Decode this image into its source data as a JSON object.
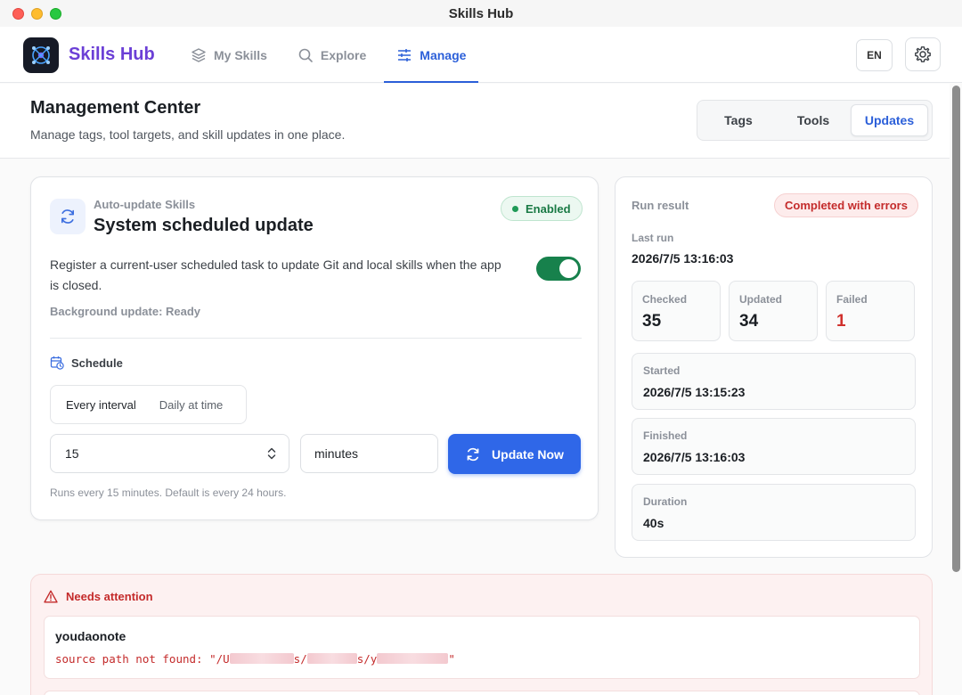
{
  "window": {
    "title": "Skills Hub"
  },
  "header": {
    "brand": "Skills Hub",
    "nav": [
      {
        "label": "My Skills",
        "icon": "layers-icon"
      },
      {
        "label": "Explore",
        "icon": "search-icon"
      },
      {
        "label": "Manage",
        "icon": "sliders-icon",
        "active": true
      }
    ],
    "language": "EN"
  },
  "page": {
    "title": "Management Center",
    "subtitle": "Manage tags, tool targets, and skill updates in one place.",
    "tabs": [
      "Tags",
      "Tools",
      "Updates"
    ],
    "active_tab": "Updates"
  },
  "auto_update": {
    "kicker": "Auto-update Skills",
    "title": "System scheduled update",
    "status_badge": "Enabled",
    "description": "Register a current-user scheduled task to update Git and local skills when the app is closed.",
    "background_status": "Background update: Ready",
    "enabled": true,
    "schedule_label": "Schedule",
    "modes": [
      "Every interval",
      "Daily at time"
    ],
    "active_mode": "Every interval",
    "interval_value": "15",
    "interval_unit": "minutes",
    "update_button": "Update Now",
    "hint": "Runs every 15 minutes. Default is every 24 hours."
  },
  "run_result": {
    "label": "Run result",
    "status": "Completed with errors",
    "last_run_label": "Last run",
    "last_run": "2026/7/5 13:16:03",
    "stats": [
      {
        "label": "Checked",
        "value": "35"
      },
      {
        "label": "Updated",
        "value": "34"
      },
      {
        "label": "Failed",
        "value": "1"
      }
    ],
    "started_label": "Started",
    "started": "2026/7/5 13:15:23",
    "finished_label": "Finished",
    "finished": "2026/7/5 13:16:03",
    "duration_label": "Duration",
    "duration": "40s"
  },
  "attention": {
    "title": "Needs attention",
    "items": [
      {
        "name": "youdaonote",
        "message_prefix": "source path not found: \"/U",
        "message_mid1": "s/",
        "message_mid2": "s/y",
        "message_suffix": "\""
      }
    ]
  },
  "colors": {
    "accent": "#2b5fd9",
    "success": "#17814c",
    "error": "#c42b2b"
  }
}
